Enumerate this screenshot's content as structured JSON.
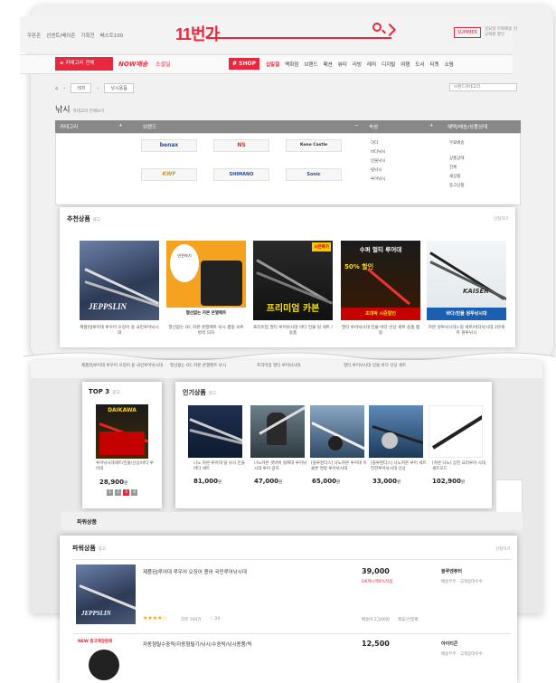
{
  "header": {
    "links": [
      "쿠폰존",
      "선센트/베이존",
      "기획전",
      "베스트100"
    ],
    "logo": "11번가",
    "badge": "SUMMER",
    "badge_sub": "일요일 무료배송 신규회원 할인"
  },
  "nav": {
    "category_btn": "≡ 카테고리 전체",
    "now": "NOW배송",
    "mart": "소셜딜",
    "shop": "# SHOP",
    "items": [
      "십일절",
      "백화점",
      "브랜드",
      "패션",
      "뷰티",
      "리빙",
      "레저",
      "디지털",
      "여행",
      "도서",
      "티켓",
      "쇼핑"
    ]
  },
  "breadcrumb": {
    "home_icon": "home-icon",
    "level1": "레저",
    "level2": "낚시용품",
    "brand_select": "브랜드카테고리"
  },
  "page": {
    "title": "낚시",
    "subtitle": "카테고리 전체보기"
  },
  "filter": {
    "col1": "카테고리",
    "col2": "브랜드",
    "col3": "속성",
    "col4": "혜택/배송/상품상태",
    "brands": [
      "benax",
      "NS",
      "Kono Castle",
      "KWF",
      "SHIMANO",
      "Sonic"
    ],
    "attrs": [
      "하다",
      "바다낚시",
      "민물낚시",
      "릴낚시",
      "루어낚시"
    ],
    "benefits": [
      "무료배송",
      "상품상태",
      "전체",
      "새상품",
      "중고상품"
    ]
  },
  "recommended": {
    "title": "추천상품",
    "ad": "광고",
    "more": "신청하기",
    "items": [
      {
        "name": "제품된J루어대 루우어 오징어 용 국민루어낚시대",
        "img": "jepp-rod"
      },
      {
        "name": "열선없는 OC 카본 온열매트 낚시 캠핑 보트 방석 의자",
        "img": "heat-mat"
      },
      {
        "name": "프리미엄 멀티 루어낚시대 바다 민물 릴 세트 /용품",
        "img": "premium-carbon"
      },
      {
        "name": "멀티 루어낚시대 민물 바다 선상 세트 용품 캠핑",
        "img": "sale-rod"
      },
      {
        "name": "카본 원투낚시대+릴 세트/바다낚시대 2본세트 원투낚시",
        "img": "white-rod"
      }
    ],
    "labels": {
      "heat_top": "인전하기",
      "heat_sub": "열선없는 카본 온열매트",
      "premium": "프리미엄 카본",
      "premium_tag": "시즌특가",
      "sale_top": "수퍼 멀티 루어대",
      "sale_pct": "50% 할인",
      "sale_bottom": "초대박 시즌할인",
      "white_brand": "KAISER",
      "white_bottom": "바다/민물 원투낚시대",
      "jepp": "JEPPSLIN"
    }
  },
  "top3": {
    "title": "TOP 3",
    "ad": "광고",
    "product_name": "루어낚시대세트/민물/선상/바다 루어대",
    "brand": "DAIKAWA",
    "price": "28,900",
    "won": "원",
    "pages": [
      "1",
      "2",
      "3",
      "4"
    ]
  },
  "popular": {
    "title": "인기상품",
    "ad": "광고",
    "items": [
      {
        "name": "나노 카본 루어대 릴 낚시 민물 바다 세트",
        "price": "81,000"
      },
      {
        "name": "나노카본 갯바위 릴찌대 루어낚시대 루어 갈치",
        "price": "47,000"
      },
      {
        "name": "[블루펀더스] 나노카본 루어대 이클론 명랑 루어낚시대",
        "price": "65,000"
      },
      {
        "name": "[블루펀더스] 나노카본 루어 세트 진한루어낚시대 선상",
        "price": "33,000"
      },
      {
        "name": "[카본 나노] 삼진 요리루어 시대 세트모드",
        "price": "102,900"
      }
    ],
    "won": "원"
  },
  "power": {
    "title": "파워상품",
    "ad": "광고",
    "more": "신청하기",
    "rows": [
      {
        "name": "제품된J루어대 루우어 오징어 용어 국민루어낚시대",
        "price": "39,000",
        "discount": "OK캐시백4%적립",
        "seller": "블루엔퓨터",
        "seller_sub": "배송무주 · 고객응대우수",
        "rating": "★★★★☆",
        "reviews": "리뷰 104건",
        "likes": "♡ 24",
        "extra": "배송비 2,500원",
        "extra2": "제휴/선결제"
      },
      {
        "name": "자동형릴수중릭/자동형릴기/낚시/수중릭/낚시용품/릭",
        "price": "12,500",
        "seller": "아이티콘",
        "seller_sub": "배송무주 · 고객응대우수",
        "tag": "NEW 중고매장판매"
      }
    ]
  },
  "strip_texts": [
    "제품된J루어대 루우어 오징어 용 국민루어낚시대",
    "열선없는 OC 카본 온열매트 낚시",
    "프리미엄 멀티 루어낚시대",
    "멀티 루어낚시대 민물 바다 선상 세트"
  ],
  "colors": {
    "accent": "#e8283c",
    "bg": "#ffffff"
  }
}
